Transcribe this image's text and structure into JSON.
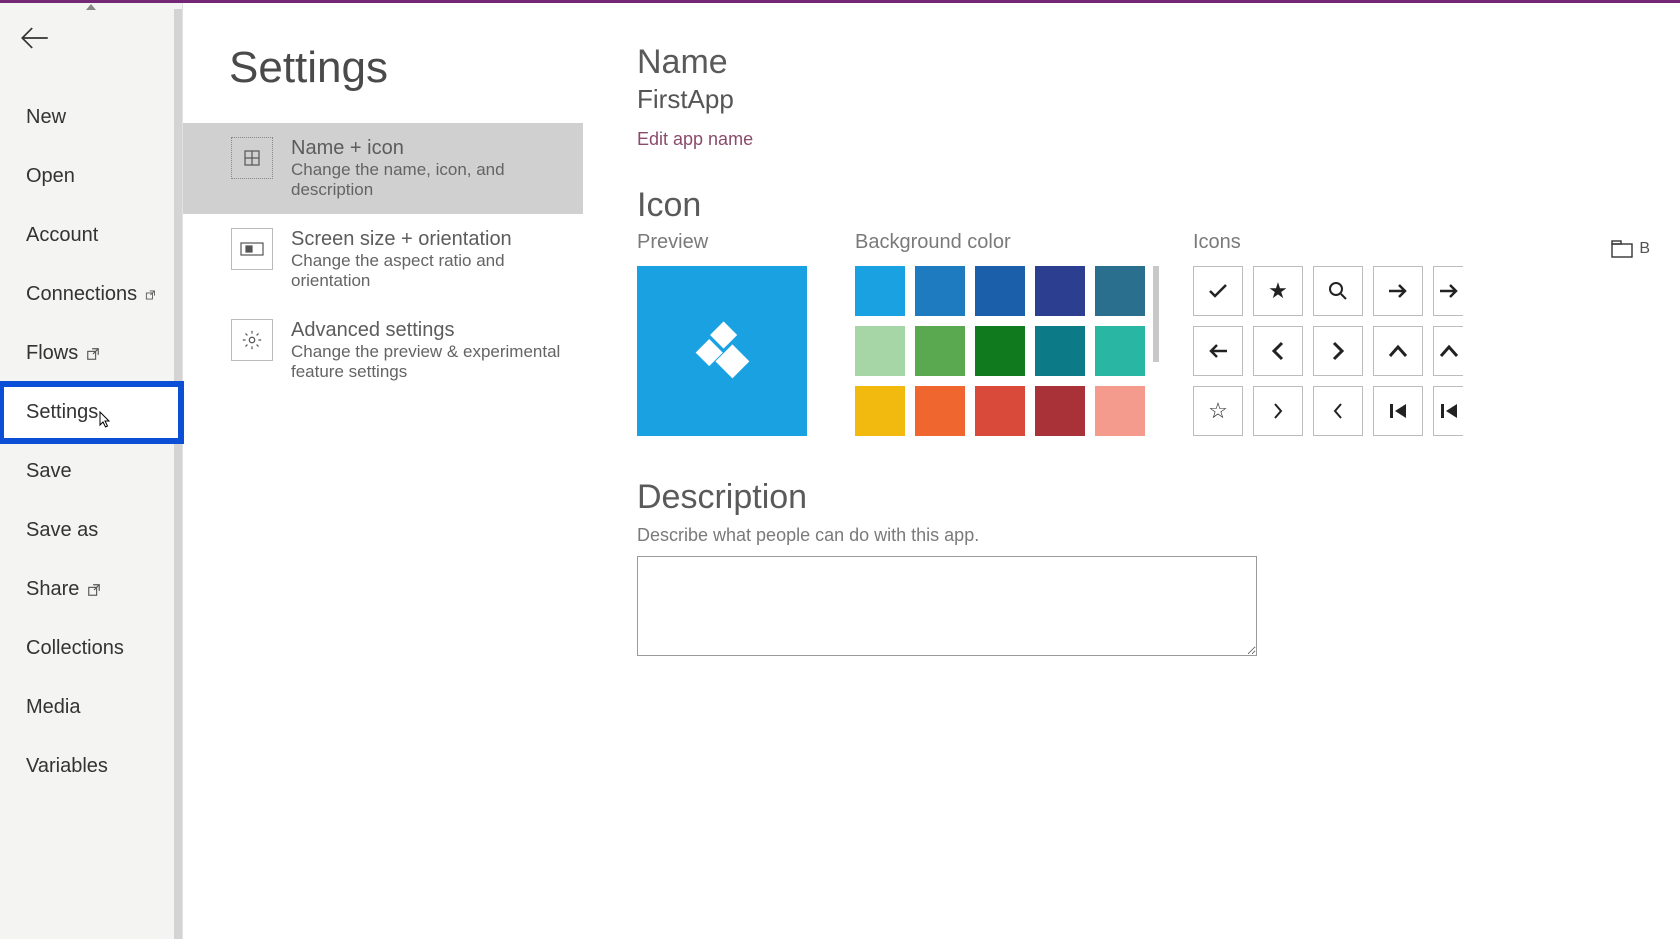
{
  "sidebar": {
    "items": [
      {
        "label": "New",
        "external": false
      },
      {
        "label": "Open",
        "external": false
      },
      {
        "label": "Account",
        "external": false
      },
      {
        "label": "Connections",
        "external": true
      },
      {
        "label": "Flows",
        "external": true
      },
      {
        "label": "Settings",
        "external": false,
        "highlighted": true
      },
      {
        "label": "Save",
        "external": false
      },
      {
        "label": "Save as",
        "external": false
      },
      {
        "label": "Share",
        "external": true
      },
      {
        "label": "Collections",
        "external": false
      },
      {
        "label": "Media",
        "external": false
      },
      {
        "label": "Variables",
        "external": false
      }
    ]
  },
  "settings_nav": {
    "title": "Settings",
    "items": [
      {
        "title": "Name + icon",
        "desc": "Change the name, icon, and description",
        "selected": true
      },
      {
        "title": "Screen size + orientation",
        "desc": "Change the aspect ratio and orientation",
        "selected": false
      },
      {
        "title": "Advanced settings",
        "desc": "Change the preview & experimental feature settings",
        "selected": false
      }
    ]
  },
  "detail": {
    "name_heading": "Name",
    "app_name": "FirstApp",
    "edit_link": "Edit app name",
    "icon_heading": "Icon",
    "preview_label": "Preview",
    "bgcolor_label": "Background color",
    "icons_label": "Icons",
    "browse_label": "B",
    "colors": [
      "#1aa1e1",
      "#1f7bbf",
      "#1b5faa",
      "#2c3e8f",
      "#2b6f8e",
      "#a6d6a6",
      "#5aa84f",
      "#0f7a1e",
      "#0d7a87",
      "#29b7a3",
      "#f2b90f",
      "#f0662f",
      "#d94a3a",
      "#a83238",
      "#f49b8e"
    ],
    "icons_grid": [
      "check",
      "star-filled",
      "search",
      "arrow-right",
      "arrow-right-cut",
      "arrow-left",
      "chevron-left",
      "chevron-right",
      "chevron-up",
      "chevron-up-cut",
      "star-outline",
      "angle-right",
      "angle-left",
      "skip-back",
      "skip-back-cut"
    ],
    "desc_heading": "Description",
    "desc_hint": "Describe what people can do with this app.",
    "desc_value": ""
  }
}
